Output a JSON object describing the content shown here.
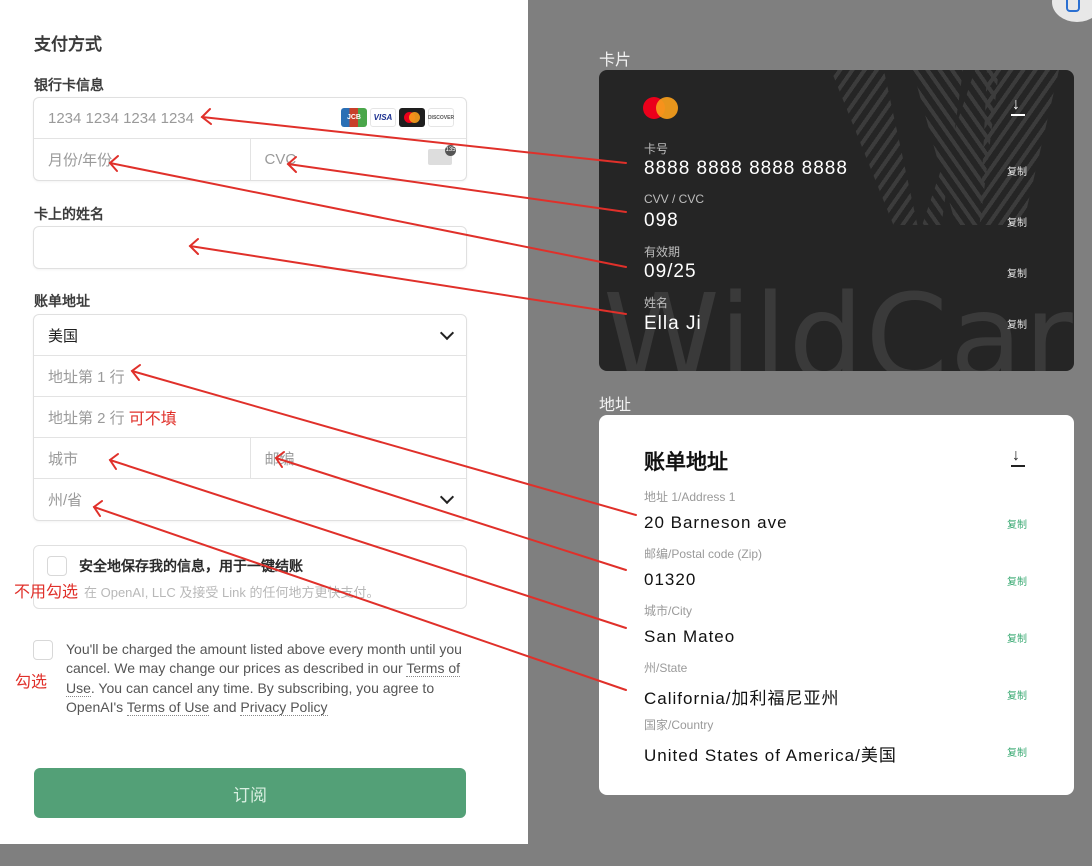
{
  "form": {
    "title": "支付方式",
    "card_info_label": "银行卡信息",
    "card_number_placeholder": "1234 1234 1234 1234",
    "card_brands": [
      "JCB",
      "VISA",
      "Mastercard",
      "DISCOVER"
    ],
    "expiry_placeholder": "月份/年份",
    "cvc_placeholder": "CVC",
    "cvc_icon_badge": "135",
    "name_label": "卡上的姓名",
    "name_value": "",
    "billing_label": "账单地址",
    "country_value": "美国",
    "address1_placeholder": "地址第 1 行",
    "address2_placeholder": "地址第 2 行",
    "address2_note": "可不填",
    "city_placeholder": "城市",
    "zip_placeholder": "邮编",
    "state_placeholder": "州/省",
    "save_info_title": "安全地保存我的信息，用于一键结账",
    "save_info_sub": "在 OpenAI, LLC 及接受 Link 的任何地方更快支付。",
    "save_info_annotation": "不用勾选",
    "terms_annotation": "勾选",
    "terms_text_1": "You'll be charged the amount listed above every month until you cancel. We may change our prices as described in our ",
    "terms_link_1": "Terms of Use",
    "terms_text_2": ". You can cancel any time. By subscribing, you agree to OpenAI's ",
    "terms_link_2": "Terms of Use",
    "terms_text_3": " and ",
    "terms_link_3": "Privacy Policy",
    "subscribe_label": "订阅"
  },
  "card_section": {
    "label": "卡片",
    "watermark": "WildCard",
    "fields": [
      {
        "label": "卡号",
        "value": "8888 8888 8888 8888",
        "copy": "复制"
      },
      {
        "label": "CVV / CVC",
        "value": "098",
        "copy": "复制"
      },
      {
        "label": "有效期",
        "value": "09/25",
        "copy": "复制"
      },
      {
        "label": "姓名",
        "value": "Ella Ji",
        "copy": "复制"
      }
    ]
  },
  "address_section": {
    "label": "地址",
    "title": "账单地址",
    "fields": [
      {
        "label": "地址 1/Address 1",
        "value": "20 Barneson ave",
        "copy": "复制"
      },
      {
        "label": "邮编/Postal code (Zip)",
        "value": "01320",
        "copy": "复制"
      },
      {
        "label": "城市/City",
        "value": "San Mateo",
        "copy": "复制"
      },
      {
        "label": "州/State",
        "value": "California/加利福尼亚州",
        "copy": "复制"
      },
      {
        "label": "国家/Country",
        "value": "United States of America/美国",
        "copy": "复制"
      }
    ]
  },
  "colors": {
    "subscribe_button": "#53a077",
    "copy_green": "#3aaa73",
    "annotation_red": "#e0302a",
    "card_bg": "#252525"
  }
}
